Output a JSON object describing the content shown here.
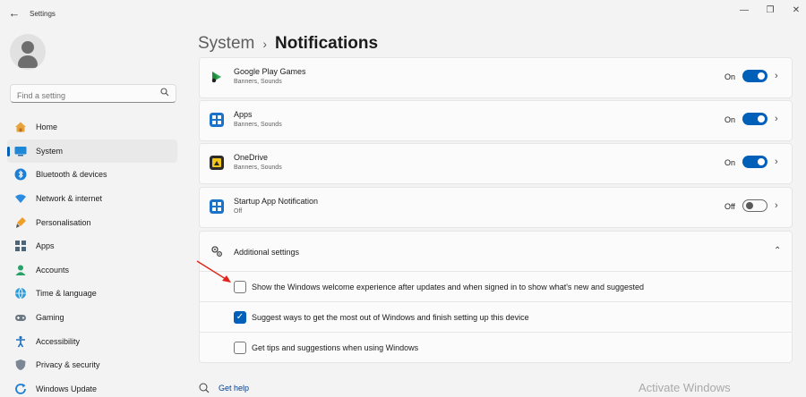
{
  "window": {
    "title": "Settings",
    "controls": [
      "minimize-icon",
      "maximize-icon",
      "close-icon"
    ]
  },
  "sidebar": {
    "search_placeholder": "Find a setting",
    "items": [
      {
        "label": "Home",
        "icon": "home-icon"
      },
      {
        "label": "System",
        "icon": "system-icon",
        "active": true
      },
      {
        "label": "Bluetooth & devices",
        "icon": "bluetooth-icon"
      },
      {
        "label": "Network & internet",
        "icon": "wifi-icon"
      },
      {
        "label": "Personalisation",
        "icon": "brush-icon"
      },
      {
        "label": "Apps",
        "icon": "apps-icon"
      },
      {
        "label": "Accounts",
        "icon": "accounts-icon"
      },
      {
        "label": "Time & language",
        "icon": "globe-icon"
      },
      {
        "label": "Gaming",
        "icon": "gaming-icon"
      },
      {
        "label": "Accessibility",
        "icon": "accessibility-icon"
      },
      {
        "label": "Privacy & security",
        "icon": "shield-icon"
      },
      {
        "label": "Windows Update",
        "icon": "update-icon"
      }
    ]
  },
  "breadcrumb": {
    "parent": "System",
    "separator": "›",
    "current": "Notifications"
  },
  "apps": [
    {
      "name": "Google Play Games",
      "detail": "Banners, Sounds",
      "state": "On",
      "enabled": true
    },
    {
      "name": "Apps",
      "detail": "Banners, Sounds",
      "state": "On",
      "enabled": true
    },
    {
      "name": "OneDrive",
      "detail": "Banners, Sounds",
      "state": "On",
      "enabled": true
    },
    {
      "name": "Startup App Notification",
      "detail": "Off",
      "state": "Off",
      "enabled": false
    }
  ],
  "additional": {
    "title": "Additional settings",
    "options": [
      {
        "label": "Show the Windows welcome experience after updates and when signed in to show what's new and suggested",
        "checked": false
      },
      {
        "label": "Suggest ways to get the most out of Windows and finish setting up this device",
        "checked": true
      },
      {
        "label": "Get tips and suggestions when using Windows",
        "checked": false
      }
    ]
  },
  "footer": {
    "help_label": "Get help",
    "watermark": "Activate Windows"
  },
  "colors": {
    "accent": "#005fb8",
    "background": "#f3f3f3",
    "card": "#fbfbfb",
    "annotation_arrow": "#e0261b"
  }
}
